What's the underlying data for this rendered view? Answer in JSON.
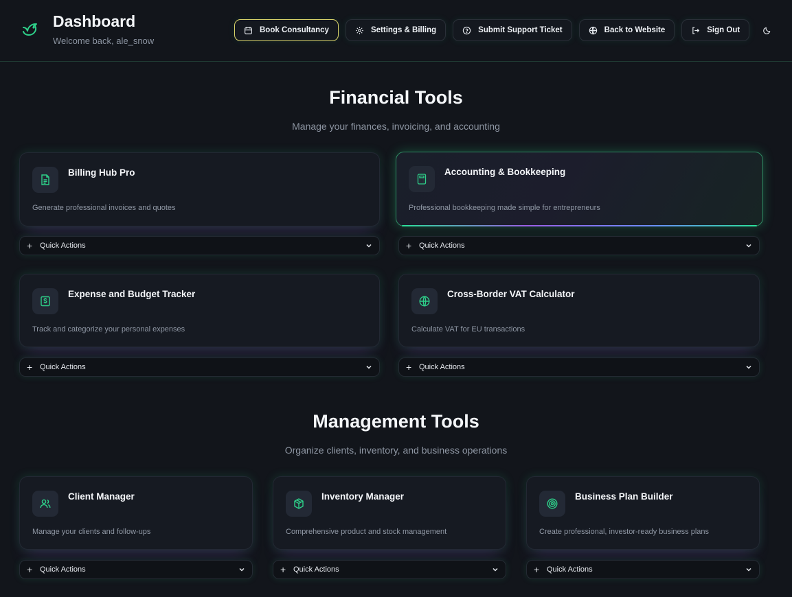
{
  "header": {
    "title": "Dashboard",
    "welcome": "Welcome back, ale_snow",
    "nav": [
      {
        "label": "Book Consultancy",
        "icon": "calendar-icon"
      },
      {
        "label": "Settings & Billing",
        "icon": "gear-icon"
      },
      {
        "label": "Submit Support Ticket",
        "icon": "help-circle-icon"
      },
      {
        "label": "Back to Website",
        "icon": "globe-icon"
      },
      {
        "label": "Sign Out",
        "icon": "sign-out-icon"
      }
    ],
    "theme_icon": "moon-icon"
  },
  "colors": {
    "accent": "#2ed18a",
    "primary_border": "#d9d36a",
    "background": "#12151b"
  },
  "financial": {
    "title": "Financial Tools",
    "subtitle": "Manage your finances, invoicing, and accounting",
    "cards": [
      {
        "title": "Billing Hub Pro",
        "desc": "Generate professional invoices and quotes",
        "icon": "document-icon",
        "quick_actions": "Quick Actions"
      },
      {
        "title": "Accounting & Bookkeeping",
        "desc": "Professional bookkeeping made simple for entrepreneurs",
        "icon": "calculator-icon",
        "quick_actions": "Quick Actions"
      },
      {
        "title": "Expense and Budget Tracker",
        "desc": "Track and categorize your personal expenses",
        "icon": "dollar-receipt-icon",
        "quick_actions": "Quick Actions"
      },
      {
        "title": "Cross-Border VAT Calculator",
        "desc": "Calculate VAT for EU transactions",
        "icon": "globe-icon",
        "quick_actions": "Quick Actions"
      }
    ]
  },
  "management": {
    "title": "Management Tools",
    "subtitle": "Organize clients, inventory, and business operations",
    "cards": [
      {
        "title": "Client Manager",
        "desc": "Manage your clients and follow-ups",
        "icon": "users-icon",
        "quick_actions": "Quick Actions"
      },
      {
        "title": "Inventory Manager",
        "desc": "Comprehensive product and stock management",
        "icon": "box-icon",
        "quick_actions": "Quick Actions"
      },
      {
        "title": "Business Plan Builder",
        "desc": "Create professional, investor-ready business plans",
        "icon": "target-icon",
        "quick_actions": "Quick Actions"
      }
    ]
  }
}
